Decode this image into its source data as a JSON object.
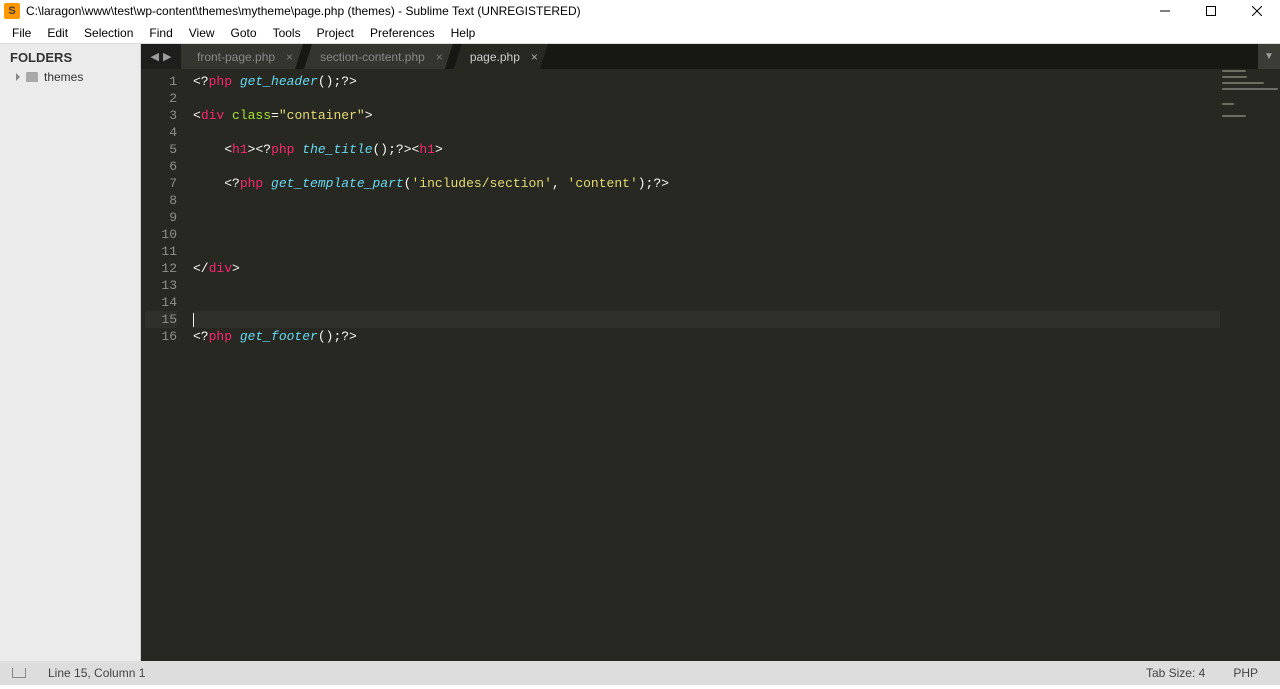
{
  "window": {
    "title": "C:\\laragon\\www\\test\\wp-content\\themes\\mytheme\\page.php (themes) - Sublime Text (UNREGISTERED)",
    "app_icon_text": "S"
  },
  "menu": [
    "File",
    "Edit",
    "Selection",
    "Find",
    "View",
    "Goto",
    "Tools",
    "Project",
    "Preferences",
    "Help"
  ],
  "sidebar": {
    "header": "FOLDERS",
    "folder": "themes"
  },
  "tabs": [
    {
      "label": "front-page.php",
      "active": false
    },
    {
      "label": "section-content.php",
      "active": false
    },
    {
      "label": "page.php",
      "active": true
    }
  ],
  "code": {
    "lines": [
      {
        "t": "php_fn_call",
        "fn": "get_header"
      },
      {
        "t": "blank"
      },
      {
        "t": "open_tag",
        "tag": "div",
        "attr": "class",
        "val": "container"
      },
      {
        "t": "blank"
      },
      {
        "t": "h1_title_line",
        "fn": "the_title"
      },
      {
        "t": "blank"
      },
      {
        "t": "php_fn_call2",
        "fn": "get_template_part",
        "s1": "includes/section",
        "s2": "content"
      },
      {
        "t": "blank"
      },
      {
        "t": "blank"
      },
      {
        "t": "blank"
      },
      {
        "t": "blank"
      },
      {
        "t": "close_tag",
        "tag": "div"
      },
      {
        "t": "blank"
      },
      {
        "t": "blank"
      },
      {
        "t": "cursor"
      },
      {
        "t": "php_fn_call",
        "fn": "get_footer"
      }
    ]
  },
  "status": {
    "position": "Line 15, Column 1",
    "tab_size": "Tab Size: 4",
    "syntax": "PHP"
  },
  "colors": {
    "kw": "#f92672",
    "fn": "#66d9ef",
    "str": "#e6db74",
    "attr": "#a6e22e"
  }
}
